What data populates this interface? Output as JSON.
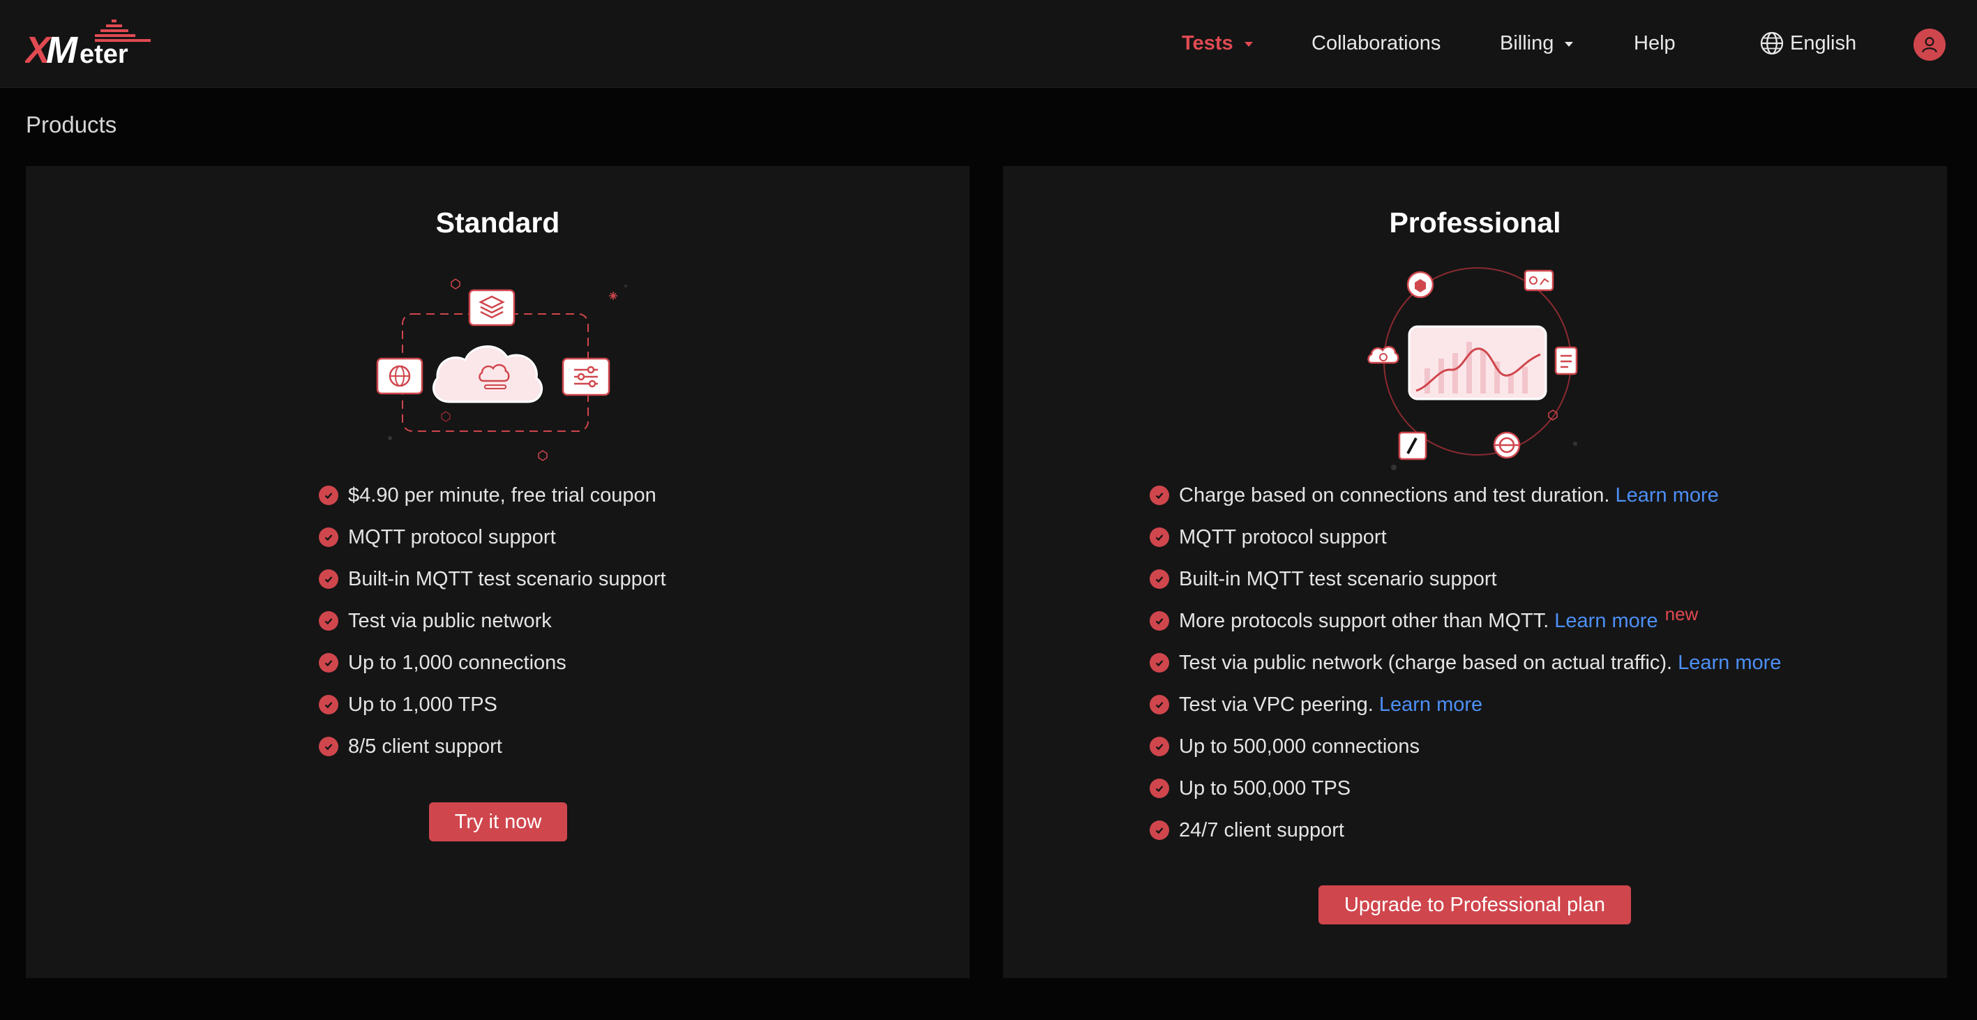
{
  "header": {
    "logo_text": "XMeter",
    "nav": [
      {
        "label": "Tests",
        "active": true,
        "dropdown": true
      },
      {
        "label": "Collaborations",
        "active": false,
        "dropdown": false
      },
      {
        "label": "Billing",
        "active": false,
        "dropdown": true
      },
      {
        "label": "Help",
        "active": false,
        "dropdown": false
      }
    ],
    "language": "English",
    "language_icon": "globe-icon",
    "avatar_icon": "user-icon"
  },
  "page": {
    "title": "Products"
  },
  "plans": [
    {
      "title": "Standard",
      "features": [
        {
          "text": "$4.90 per minute, free trial coupon"
        },
        {
          "text": "MQTT protocol support"
        },
        {
          "text": "Built-in MQTT test scenario support"
        },
        {
          "text": "Test via public network"
        },
        {
          "text": "Up to 1,000 connections"
        },
        {
          "text": "Up to 1,000 TPS"
        },
        {
          "text": "8/5 client support"
        }
      ],
      "button": "Try it now"
    },
    {
      "title": "Professional",
      "features": [
        {
          "text": "Charge based on connections and test duration.",
          "link": "Learn more"
        },
        {
          "text": "MQTT protocol support"
        },
        {
          "text": "Built-in MQTT test scenario support"
        },
        {
          "text": "More protocols support other than MQTT.",
          "link": "Learn more",
          "badge": "new"
        },
        {
          "text": "Test via public network (charge based on actual traffic).",
          "link": "Learn more"
        },
        {
          "text": "Test via VPC peering.",
          "link": "Learn more"
        },
        {
          "text": "Up to 500,000 connections"
        },
        {
          "text": "Up to 500,000 TPS"
        },
        {
          "text": "24/7 client support"
        }
      ],
      "button": "Upgrade to Professional plan"
    }
  ],
  "colors": {
    "accent": "#d0464d",
    "link": "#4d8ff5",
    "background": "#050505",
    "card": "#151515",
    "header": "#141414"
  }
}
